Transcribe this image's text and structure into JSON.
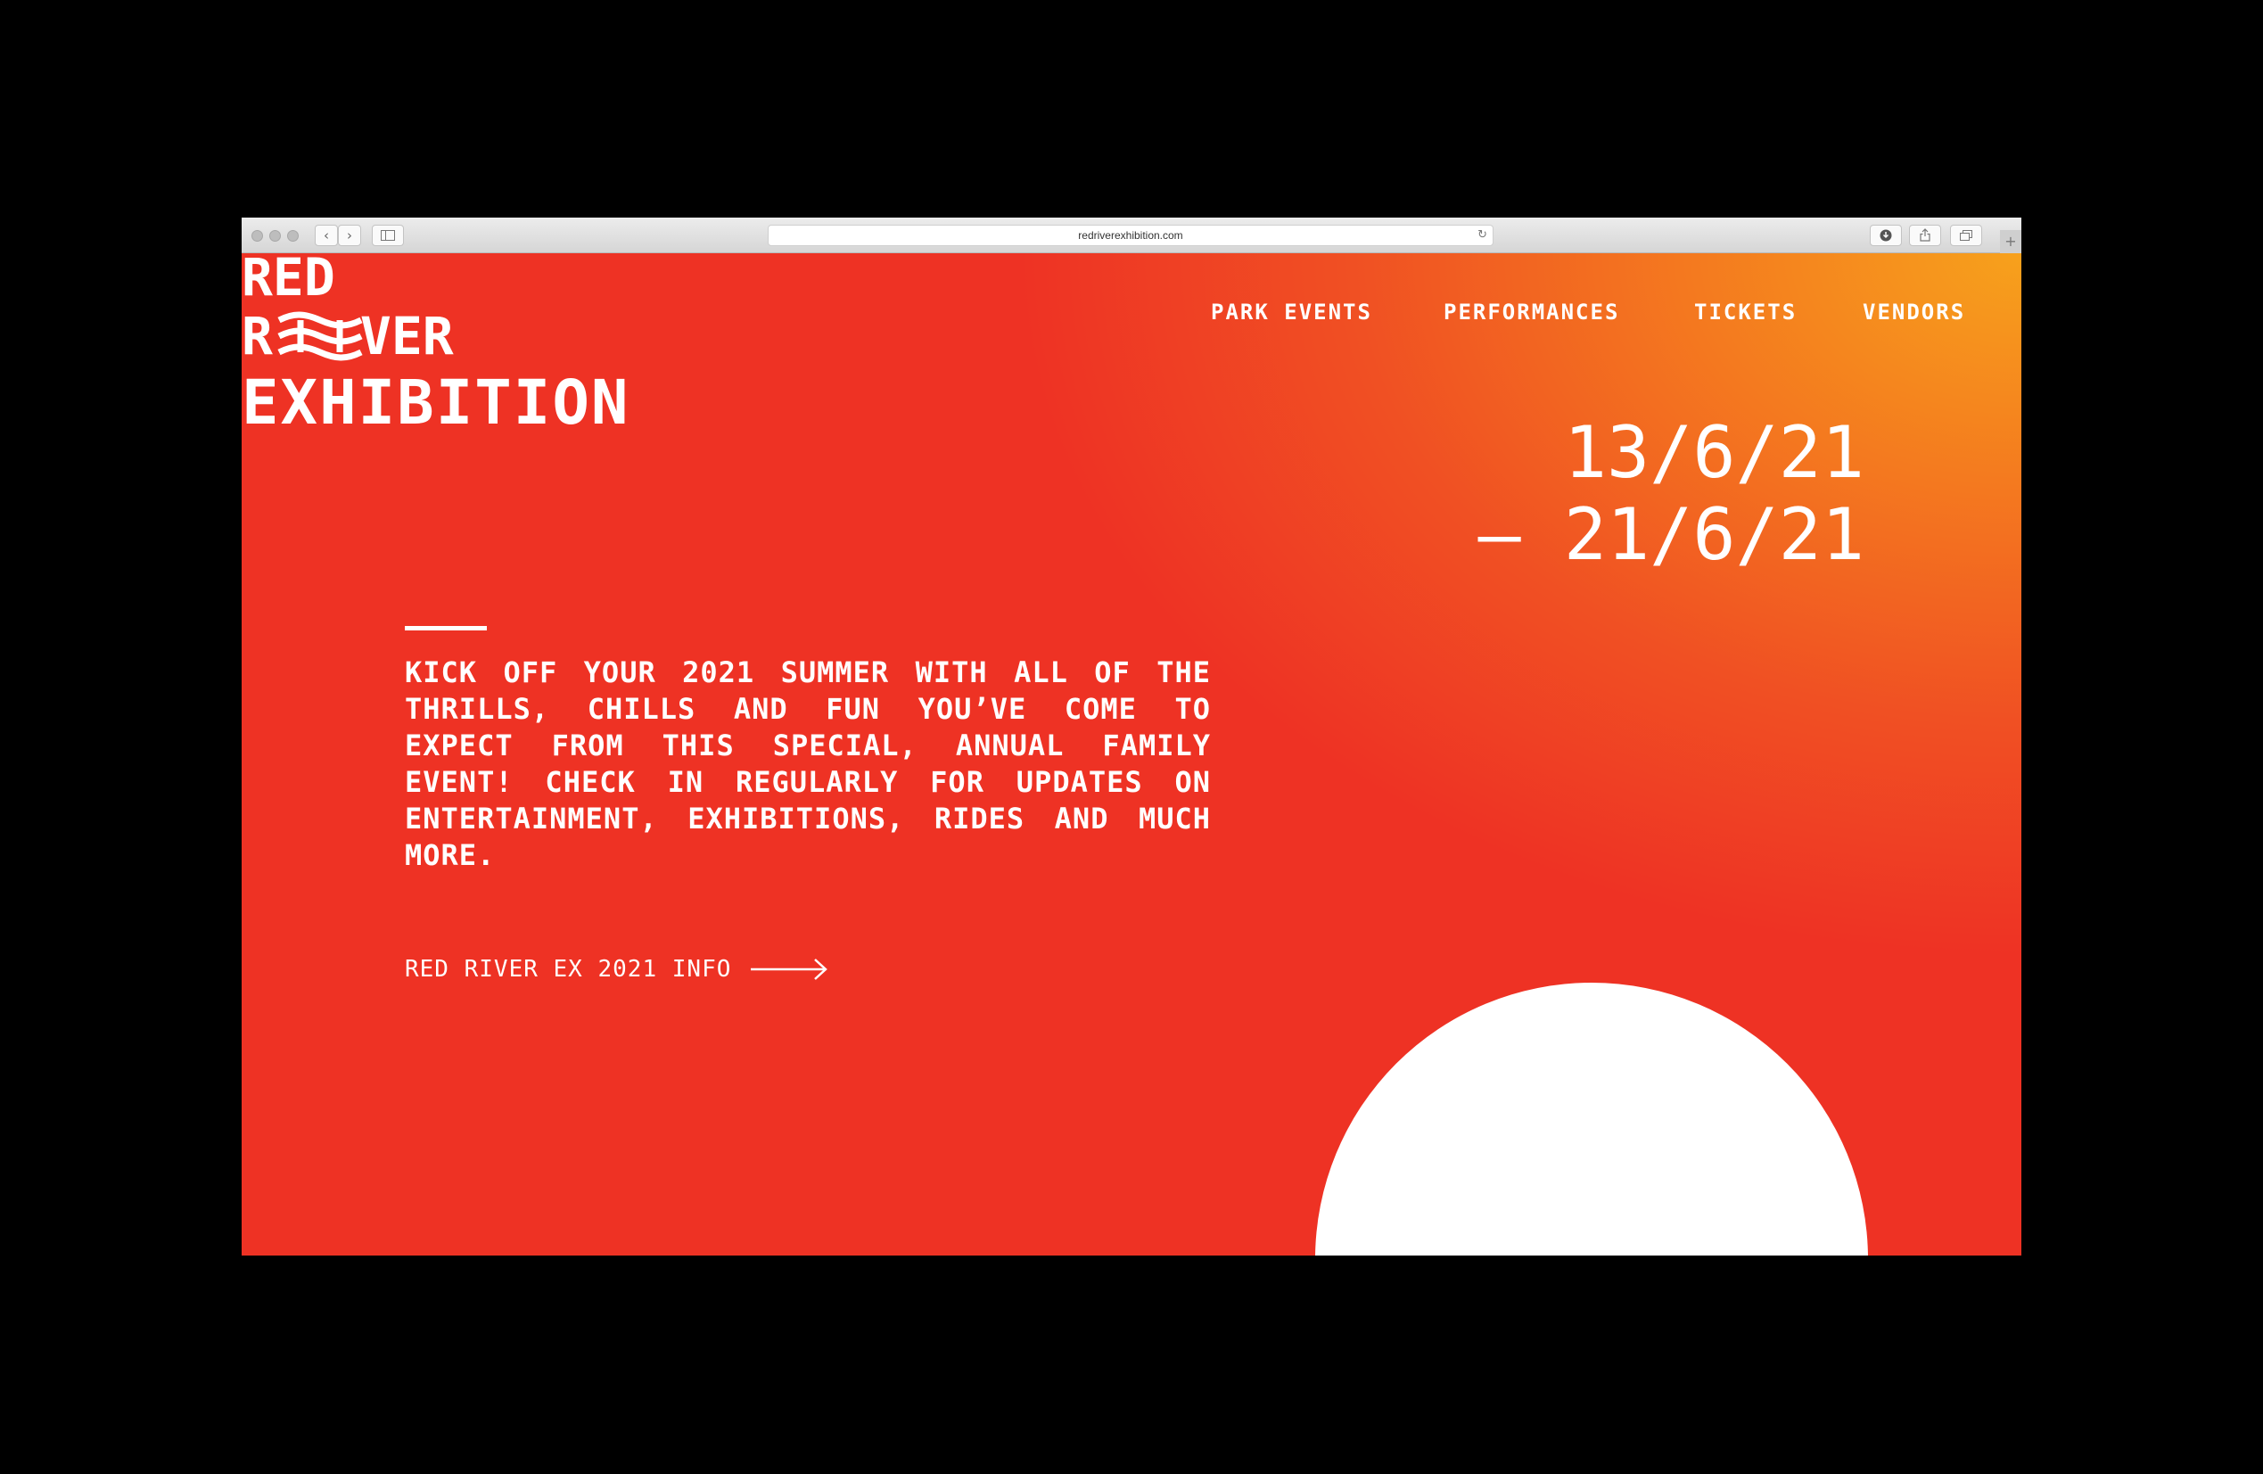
{
  "browser": {
    "url": "redriverexhibition.com",
    "reload_glyph": "↻",
    "back_glyph": "‹",
    "forward_glyph": "›",
    "new_tab_glyph": "+"
  },
  "logo": {
    "line1": "RED",
    "line2_start": "R",
    "line2_end": "VER",
    "line3": "EXHIBITION"
  },
  "nav": [
    {
      "label": "PARK EVENTS"
    },
    {
      "label": "PERFORMANCES"
    },
    {
      "label": "TICKETS"
    },
    {
      "label": "VENDORS"
    }
  ],
  "dates": {
    "start": "13/6/21",
    "end": "– 21/6/21"
  },
  "intro": "KICK OFF YOUR 2021 SUMMER WITH ALL OF THE THRILLS, CHILLS AND FUN YOU’VE COME TO EXPECT FROM THIS SPECIAL, ANNUAL FAMILY EVENT! CHECK IN REGULARLY FOR UPDATES ON ENTERTAINMENT, EXHIBITIONS, RIDES AND MUCH MORE.",
  "info_link": "RED RIVER EX 2021 INFO",
  "colors": {
    "background_red": "#ee3224",
    "gradient_orange": "#f7a11c",
    "text": "#ffffff",
    "circle": "#ffffff"
  },
  "icons": [
    "back-icon",
    "forward-icon",
    "sidebar-icon",
    "reload-icon",
    "download-icon",
    "share-icon",
    "tabs-icon",
    "arrow-right-icon",
    "wave-icon"
  ]
}
